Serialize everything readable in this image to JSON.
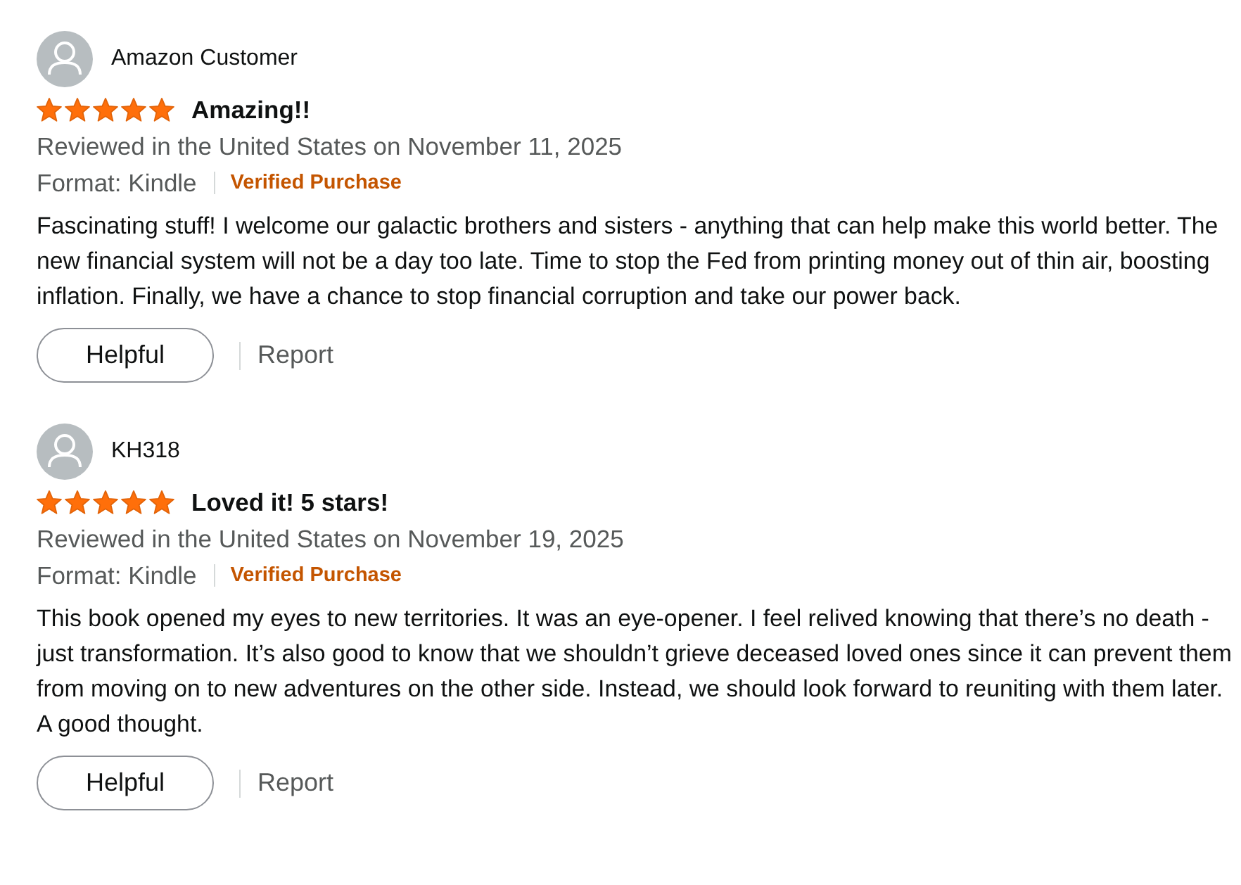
{
  "reviews": [
    {
      "author": "Amazon Customer",
      "stars": 5,
      "title": "Amazing!!",
      "date_line": "Reviewed in the United States on November 11, 2025",
      "format": "Format: Kindle",
      "badge": "Verified Purchase",
      "body": "Fascinating stuff! I welcome our galactic brothers and sisters - anything that can help make this world better. The new financial system will not be a day too late. Time to stop the Fed from printing money out of thin air, boosting inflation. Finally, we have a chance to stop financial corruption and take our power back.",
      "helpful_button": "Helpful",
      "report_link": "Report"
    },
    {
      "author": "KH318",
      "stars": 5,
      "title": "Loved it! 5 stars!",
      "date_line": "Reviewed in the United States on November 19, 2025",
      "format": "Format: Kindle",
      "badge": "Verified Purchase",
      "body": "This book opened my eyes to new territories. It was an eye-opener. I feel relived knowing that there’s no death - just transformation. It’s also good to know that we shouldn’t grieve deceased loved ones since it can prevent them from moving on to new adventures on the other side. Instead, we should look forward to reuniting with them later. A good thought.",
      "helpful_button": "Helpful",
      "report_link": "Report"
    }
  ]
}
